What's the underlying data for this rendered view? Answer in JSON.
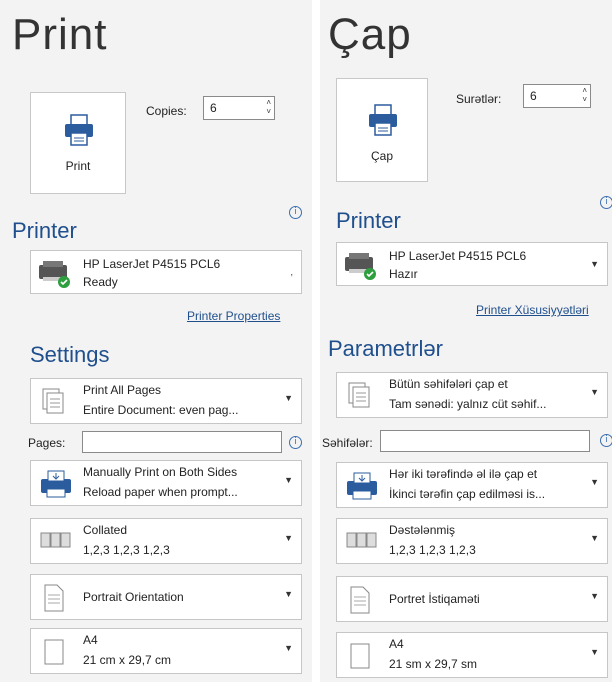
{
  "left": {
    "title": "Print",
    "print_button": "Print",
    "copies_label": "Copies:",
    "copies_value": "6",
    "printer_section": "Printer",
    "printer_name": "HP LaserJet P4515 PCL6",
    "printer_status": "Ready",
    "printer_properties": "Printer Properties",
    "settings_section": "Settings",
    "pages_label": "Pages:",
    "pages_value": "",
    "settings": [
      {
        "line1": "Print All Pages",
        "line2": "Entire Document: even pag..."
      },
      {
        "line1": "Manually Print on Both Sides",
        "line2": "Reload paper when prompt..."
      },
      {
        "line1": "Collated",
        "line2": "1,2,3   1,2,3   1,2,3"
      },
      {
        "line1": "Portrait Orientation",
        "line2": ""
      },
      {
        "line1": "A4",
        "line2": "21 cm x 29,7 cm"
      }
    ]
  },
  "right": {
    "title": "Çap",
    "print_button": "Çap",
    "copies_label": "Surətlər:",
    "copies_value": "6",
    "printer_section": "Printer",
    "printer_name": "HP LaserJet P4515 PCL6",
    "printer_status": "Hazır",
    "printer_properties": "Printer Xüsusiyyətləri",
    "settings_section": "Parametrlər",
    "pages_label": "Səhifələr:",
    "pages_value": "",
    "settings": [
      {
        "line1": "Bütün səhifələri çap et",
        "line2": "Tam sənədi: yalnız cüt səhif..."
      },
      {
        "line1": "Hər iki tərəfində əl ilə çap et",
        "line2": "İkinci tərəfin çap edilməsi is..."
      },
      {
        "line1": "Dəstələnmiş",
        "line2": "1,2,3   1,2,3   1,2,3"
      },
      {
        "line1": "Portret İstiqaməti",
        "line2": ""
      },
      {
        "line1": "A4",
        "line2": "21 sm x 29,7 sm"
      }
    ]
  },
  "icons": {
    "printer": "printer-icon",
    "info": "info-icon",
    "dropdown": "chevron-down-icon",
    "spinner": "spinner-icon",
    "pages": "pages-icon",
    "duplex": "manual-duplex-icon",
    "collated": "collated-icon",
    "portrait": "portrait-icon",
    "paper": "paper-size-icon",
    "status": "ready-check-icon"
  },
  "colors": {
    "accent": "#1f4f8c",
    "ready": "#2e9e3e",
    "printer_icon": "#2b5c9e"
  }
}
